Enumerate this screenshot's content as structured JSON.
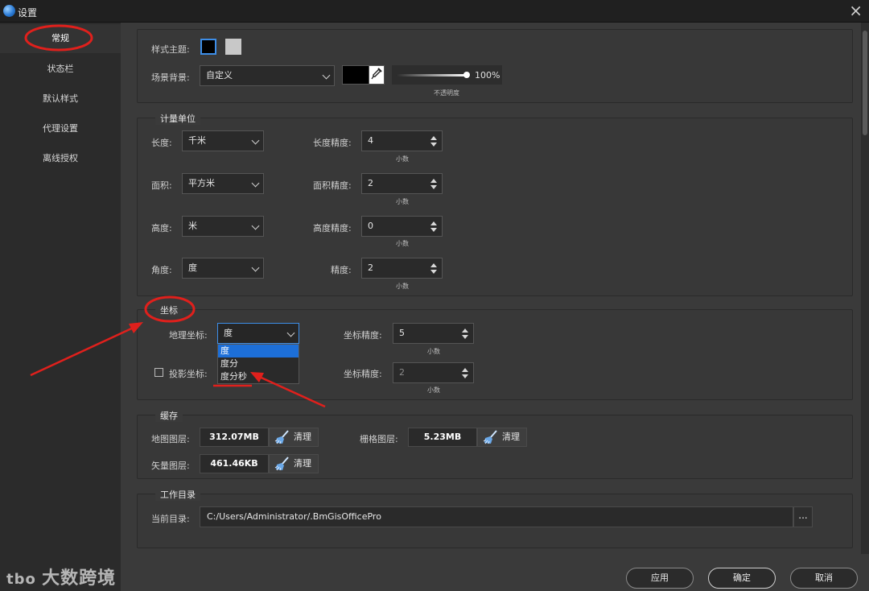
{
  "window": {
    "title": "设置"
  },
  "sidebar": {
    "items": [
      {
        "label": "常规"
      },
      {
        "label": "状态栏"
      },
      {
        "label": "默认样式"
      },
      {
        "label": "代理设置"
      },
      {
        "label": "离线授权"
      }
    ],
    "active": "常规"
  },
  "style": {
    "theme_label": "样式主题:",
    "scene_bg_label": "场景背景:",
    "scene_bg_value": "自定义",
    "opacity_value": "100%",
    "opacity_fraction": 1.0,
    "opacity_caption": "不透明度"
  },
  "units": {
    "title": "计量单位",
    "length_label": "长度:",
    "length_value": "千米",
    "area_label": "面积:",
    "area_value": "平方米",
    "height_label": "高度:",
    "height_value": "米",
    "angle_label": "角度:",
    "angle_value": "度",
    "length_precision_label": "长度精度:",
    "length_precision_value": "4",
    "area_precision_label": "面积精度:",
    "area_precision_value": "2",
    "height_precision_label": "高度精度:",
    "height_precision_value": "0",
    "precision_label": "精度:",
    "precision_value": "2",
    "decimal_caption": "小数"
  },
  "coords": {
    "title": "坐标",
    "geo_label": "地理坐标:",
    "geo_value": "度",
    "geo_options": [
      "度",
      "度分",
      "度分秒"
    ],
    "geo_selected": "度",
    "proj_label": "投影坐标:",
    "coord_precision_label": "坐标精度:",
    "geo_precision_value": "5",
    "proj_precision_value": "2",
    "decimal_caption": "小数"
  },
  "cache": {
    "title": "缓存",
    "map_layer_label": "地图图层:",
    "map_layer_size": "312.07MB",
    "raster_layer_label": "栅格图层:",
    "raster_layer_size": "5.23MB",
    "vector_layer_label": "矢量图层:",
    "vector_layer_size": "461.46KB",
    "clear_label": "清理"
  },
  "workdir": {
    "title": "工作目录",
    "current_label": "当前目录:",
    "path": "C:/Users/Administrator/.BmGisOfficePro",
    "browse_label": "..."
  },
  "footer": {
    "apply": "应用",
    "ok": "确定",
    "cancel": "取消"
  },
  "watermark": "大数跨境",
  "colors": {
    "accent": "#1d6fd8",
    "annotation": "#e0201c",
    "theme_dark": "#000000",
    "theme_light": "#c8c8c8"
  }
}
